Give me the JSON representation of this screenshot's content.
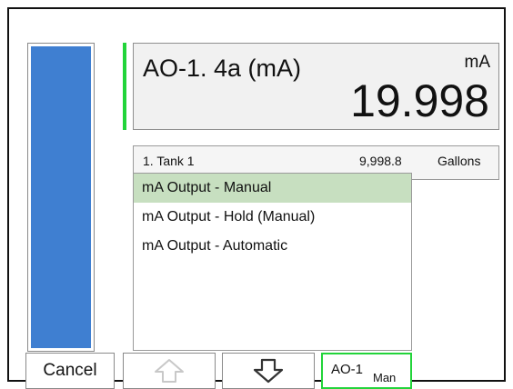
{
  "display": {
    "tag": "AO-1. 4a (mA)",
    "unit": "mA",
    "value": "19.998"
  },
  "bargraph": {
    "level": 1.0,
    "color": "#3f7fd1"
  },
  "info_row": {
    "name": "1. Tank 1",
    "value": "9,998.8",
    "unit": "Gallons"
  },
  "mode_list": {
    "items": [
      {
        "label": "mA Output - Manual",
        "selected": true
      },
      {
        "label": "mA Output - Hold (Manual)",
        "selected": false
      },
      {
        "label": "mA Output - Automatic",
        "selected": false
      }
    ]
  },
  "buttons": {
    "cancel_label": "Cancel",
    "up_icon": "arrow-up-icon",
    "up_enabled": false,
    "down_icon": "arrow-down-icon",
    "down_enabled": true,
    "mode_tag": "AO-1",
    "mode_state": "Man"
  },
  "colors": {
    "accent": "#22d43a",
    "selection": "#c7dfc0",
    "disabled": "#c8c8c8"
  }
}
